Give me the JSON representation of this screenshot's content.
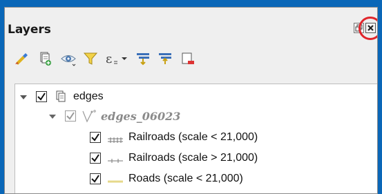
{
  "panel": {
    "title": "Layers"
  },
  "toolbar": {
    "icons": [
      "style-brush-icon",
      "add-group-icon",
      "visibility-eye-icon",
      "filter-funnel-icon",
      "expression-filter-icon",
      "expand-all-icon",
      "collapse-all-icon",
      "remove-layer-icon"
    ]
  },
  "tree": {
    "group": {
      "label": "edges",
      "checked": true
    },
    "layer": {
      "label": "edges_06023",
      "checked": true
    },
    "legend": [
      {
        "label": "Railroads (scale < 21,000)",
        "checked": true,
        "symbol": "railroad-major"
      },
      {
        "label": "Railroads (scale > 21,000)",
        "checked": true,
        "symbol": "railroad-minor"
      },
      {
        "label": "Roads (scale < 21,000)",
        "checked": true,
        "symbol": "road"
      }
    ]
  },
  "colors": {
    "background": "#0a67b8",
    "highlight_circle": "#e0252b",
    "road_symbol": "#e6d98a"
  }
}
